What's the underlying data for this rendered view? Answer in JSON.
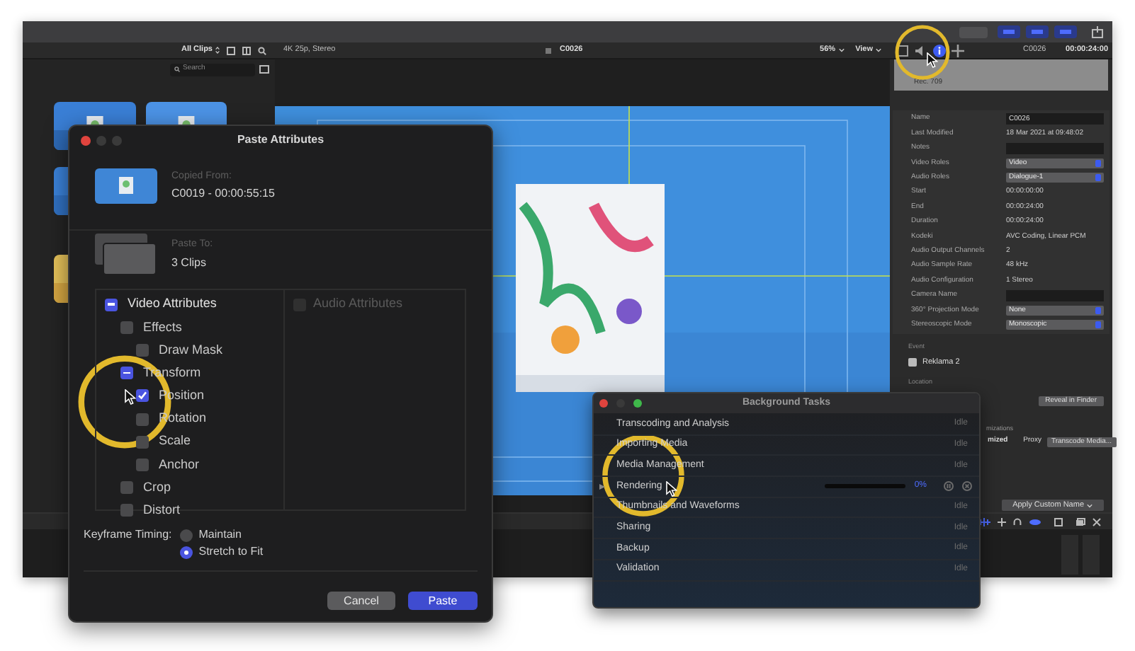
{
  "toolbar": {
    "layout_buttons": [
      {
        "on": true
      },
      {
        "on": true
      },
      {
        "on": true
      }
    ]
  },
  "browser": {
    "filter": "All Clips",
    "search_placeholder": "Search"
  },
  "viewer": {
    "format": "4K 25p, Stereo",
    "clip": "C0026",
    "zoom": "56%",
    "view": "View"
  },
  "inspector": {
    "tabs": [
      {
        "kind": "film",
        "selected": false
      },
      {
        "kind": "audio",
        "selected": false
      },
      {
        "kind": "info",
        "selected": true
      },
      {
        "kind": "transform",
        "selected": false
      }
    ],
    "clip": "C0026",
    "time": "00:00:24:00",
    "format_note": "Rec. 709",
    "rows": [
      {
        "label": "Name",
        "value": "C0026",
        "kind": "field"
      },
      {
        "label": "Last Modified",
        "value": "18 Mar 2021 at 09:48:02",
        "kind": "text"
      },
      {
        "label": "Notes",
        "kind": "field"
      },
      {
        "label": "Video Roles",
        "value": "Video",
        "kind": "dropdown"
      },
      {
        "label": "Audio Roles",
        "value": "Dialogue-1",
        "kind": "dropdown"
      },
      {
        "label": "Start",
        "value": "00:00:00:00",
        "kind": "text"
      },
      {
        "label": "End",
        "value": "00:00:24:00",
        "kind": "text"
      },
      {
        "label": "Duration",
        "value": "00:00:24:00",
        "kind": "text"
      },
      {
        "label": "Kodeki",
        "value": "AVC Coding, Linear PCM",
        "kind": "text"
      },
      {
        "label": "Audio Output Channels",
        "value": "2",
        "kind": "text"
      },
      {
        "label": "Audio Sample Rate",
        "value": "48 kHz",
        "kind": "text"
      },
      {
        "label": "Audio Configuration",
        "value": "1 Stereo",
        "kind": "text"
      },
      {
        "label": "Camera Name",
        "kind": "field"
      },
      {
        "label": "360° Projection Mode",
        "value": "None",
        "kind": "dropdown"
      },
      {
        "label": "Stereoscopic Mode",
        "value": "Monoscopic",
        "kind": "dropdown"
      }
    ],
    "event_label": "Event",
    "event": "Reklama 2",
    "location_label": "Location",
    "reveal_button": "Reveal in Finder",
    "optimizations_fragment": "mizations",
    "optimized_fragment": "mized",
    "proxy": "Proxy",
    "transcode_button": "Transcode Media...",
    "apply_button": "Apply Custom Name"
  },
  "paste_dialog": {
    "title": "Paste Attributes",
    "copied_from_label": "Copied From:",
    "copied_from": "C0019 - 00:00:55:15",
    "paste_to_label": "Paste To:",
    "paste_to": "3 Clips",
    "video": {
      "label": "Video Attributes",
      "mixed": true,
      "children": [
        {
          "label": "Effects",
          "checked": false,
          "children": [
            {
              "label": "Draw Mask",
              "checked": false
            }
          ]
        },
        {
          "label": "Transform",
          "mixed": true,
          "children": [
            {
              "label": "Position",
              "checked": true
            },
            {
              "label": "Rotation",
              "checked": false
            },
            {
              "label": "Scale",
              "checked": false
            },
            {
              "label": "Anchor",
              "checked": false
            }
          ]
        },
        {
          "label": "Crop",
          "checked": false
        },
        {
          "label": "Distort",
          "checked": false
        }
      ]
    },
    "audio": {
      "label": "Audio Attributes",
      "checked": false,
      "disabled": true
    },
    "keyframe_label": "Keyframe Timing:",
    "keyframe_options": [
      {
        "label": "Maintain",
        "selected": false
      },
      {
        "label": "Stretch to Fit",
        "selected": true
      }
    ],
    "cancel": "Cancel",
    "paste": "Paste"
  },
  "tasks_dialog": {
    "title": "Background Tasks",
    "tasks": [
      {
        "name": "Transcoding and Analysis",
        "kind": "idle",
        "status": "Idle"
      },
      {
        "name": "Importing Media",
        "kind": "idle",
        "status": "Idle"
      },
      {
        "name": "Media Management",
        "kind": "idle",
        "status": "Idle"
      },
      {
        "name": "Rendering",
        "kind": "progress",
        "level": 0,
        "status": "0%"
      },
      {
        "name": "Thumbnails and Waveforms",
        "kind": "idle",
        "status": "Idle"
      },
      {
        "name": "Sharing",
        "kind": "idle",
        "status": "Idle"
      },
      {
        "name": "Backup",
        "kind": "idle",
        "status": "Idle"
      },
      {
        "name": "Validation",
        "kind": "idle",
        "status": "Idle"
      }
    ]
  }
}
